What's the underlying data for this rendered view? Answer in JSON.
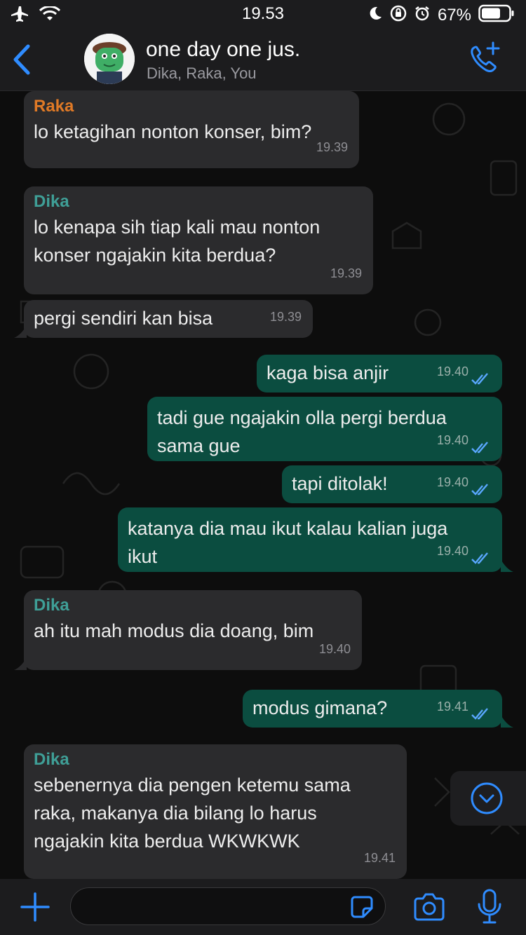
{
  "status_bar": {
    "time": "19.53",
    "battery": "67%"
  },
  "header": {
    "title": "one day one jus.",
    "subtitle": "Dika, Raka, You"
  },
  "messages": [
    {
      "sender": "Raka",
      "text": "lo ketagihan nonton konser, bim?",
      "time": "19.39",
      "direction": "in"
    },
    {
      "sender": "Dika",
      "text": "lo kenapa sih tiap kali mau nonton\nkonser ngajakin kita berdua?",
      "time": "19.39",
      "direction": "in"
    },
    {
      "text": "pergi sendiri kan bisa",
      "time": "19.39",
      "direction": "in"
    },
    {
      "text": "kaga bisa anjir",
      "time": "19.40",
      "direction": "out"
    },
    {
      "text": "tadi gue ngajakin olla pergi berdua\nsama gue",
      "time": "19.40",
      "direction": "out"
    },
    {
      "text": "tapi ditolak!",
      "time": "19.40",
      "direction": "out"
    },
    {
      "text": "katanya dia mau ikut kalau kalian juga\nikut",
      "time": "19.40",
      "direction": "out"
    },
    {
      "sender": "Dika",
      "text": "ah itu mah modus dia doang, bim",
      "time": "19.40",
      "direction": "in"
    },
    {
      "text": "modus gimana?",
      "time": "19.41",
      "direction": "out"
    },
    {
      "sender": "Dika",
      "text": "sebenernya dia pengen ketemu sama\nraka, makanya dia bilang lo harus\nngajakin kita berdua WKWKWK",
      "time": "19.41",
      "direction": "in"
    }
  ],
  "input": {
    "value": "",
    "placeholder": ""
  },
  "colors": {
    "accent": "#2f8cff",
    "outgoing": "#0b4d40",
    "incoming": "#2b2b2d",
    "raka": "#e07a26",
    "dika": "#3f9f97"
  }
}
